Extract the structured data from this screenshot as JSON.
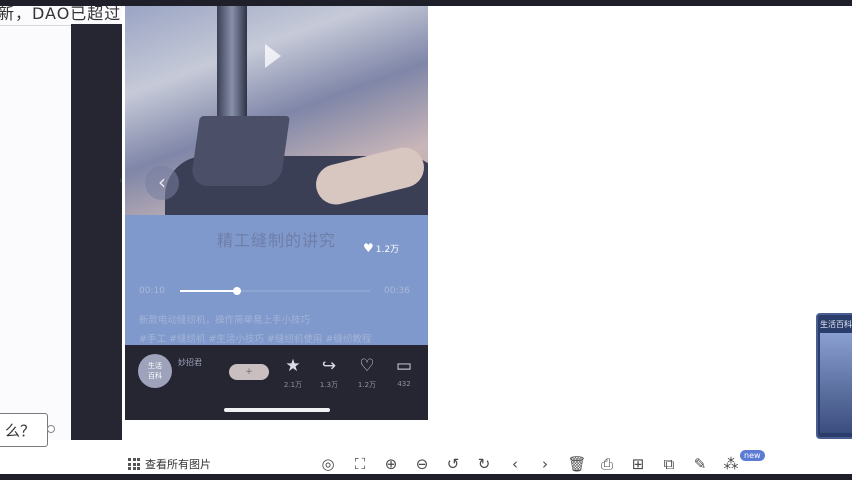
{
  "background_page": {
    "heading": "新，DAO已超过",
    "question": "么？"
  },
  "media": {
    "title": "精工缝制的讲究",
    "likes_label": "1.2万",
    "time_current": "00:10",
    "time_total": "00:36",
    "progress_fraction": 0.3,
    "description_line1": "新款电动缝纫机，操作简单易上手小技巧",
    "description_line2": "#手工 #缝纫机 #生活小技巧 #缝纫机使用 #缝纫教程",
    "author_avatar_text": "生活\n百科",
    "author_name": "妙招君",
    "follow_label": "+",
    "actions": [
      {
        "icon": "star-icon",
        "glyph": "★",
        "count": "2.1万"
      },
      {
        "icon": "share-icon",
        "glyph": "↪",
        "count": "1.3万"
      },
      {
        "icon": "heart-icon",
        "glyph": "♡",
        "count": "1.2万"
      },
      {
        "icon": "comment-icon",
        "glyph": "▭",
        "count": "432"
      }
    ]
  },
  "thumbnail": {
    "label": "生活百科"
  },
  "toolbar": {
    "view_all_label": "查看所有图片",
    "new_badge": "new"
  },
  "colors": {
    "info_panel": "#7f99cc",
    "action_bar": "#262632",
    "new_badge": "#5b7bd5"
  }
}
